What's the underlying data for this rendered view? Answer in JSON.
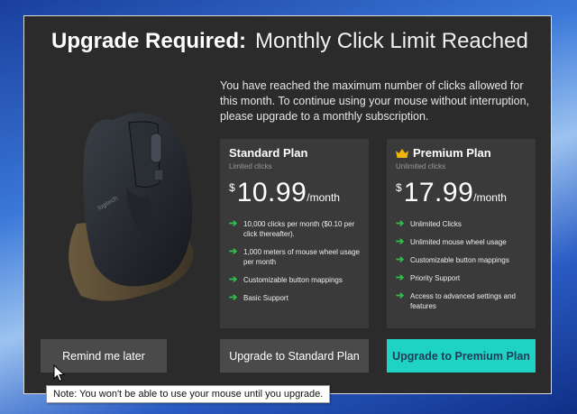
{
  "dialog": {
    "title_bold": "Upgrade Required:",
    "title_light": "Monthly Click Limit Reached",
    "intro": "You have reached the maximum number of clicks allowed for this month.  To continue using your mouse without interruption, please upgrade to a monthly subscription.",
    "mouse_image": "logitech-mouse-icon",
    "mouse_brand": "logitech"
  },
  "plans": {
    "standard": {
      "name": "Standard Plan",
      "subtitle": "Limited clicks",
      "currency": "$",
      "price": "10.99",
      "period": "/month",
      "features": [
        "10,000 clicks per month ($0.10 per click thereafter).",
        "1,000 meters of mouse wheel usage per month",
        "Customizable button mappings",
        "Basic Support"
      ]
    },
    "premium": {
      "name": "Premium Plan",
      "subtitle": "Unlimited clicks",
      "currency": "$",
      "price": "17.99",
      "period": "/month",
      "icon": "crown-icon",
      "features": [
        "Unlimited Clicks",
        "Unlimited mouse wheel usage",
        "Customizable button mappings",
        "Priority Support",
        "Access to advanced settings and features"
      ]
    }
  },
  "buttons": {
    "remind": "Remind me later",
    "standard": "Upgrade to Standard Plan",
    "premium": "Upgrade to Premium Plan"
  },
  "tooltip": {
    "text": "Note:  You won't be able to use your mouse until you upgrade."
  },
  "colors": {
    "dialog_bg": "#2b2b2b",
    "card_bg": "#3a3a3a",
    "accent": "#1fd3c4",
    "check_green": "#2fc14a",
    "crown_gold": "#f2b705"
  }
}
